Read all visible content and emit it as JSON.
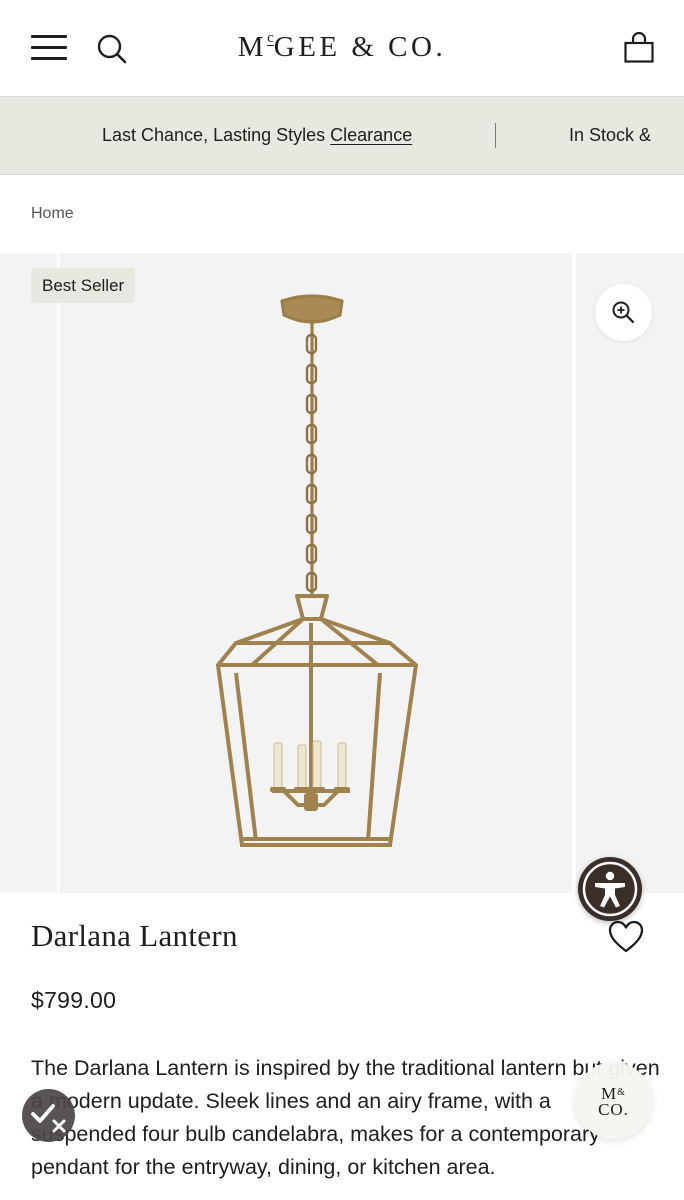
{
  "header": {
    "logo_main": "McGEE & CO.",
    "logo_prefix": "M",
    "logo_sup": "c",
    "logo_rest": "GEE & CO.",
    "menu_icon": "hamburger-menu-icon",
    "search_icon": "search-icon",
    "cart_icon": "shopping-bag-icon"
  },
  "promo": {
    "text": "Last Chance, Lasting Styles",
    "link": "Clearance",
    "text2": "In Stock &"
  },
  "breadcrumb": {
    "home": "Home"
  },
  "gallery": {
    "badge": "Best Seller",
    "zoom_icon": "zoom-in-icon",
    "image_subject": "lantern-pendant-image"
  },
  "product": {
    "title": "Darlana Lantern",
    "price": "$799.00",
    "description": "The Darlana Lantern is inspired by the traditional lantern but given a modern update. Sleek lines and an airy frame, with a suspended four bulb candelabra, makes for a contemporary pendant for the entryway, dining, or kitchen area.",
    "wishlist_icon": "heart-icon"
  },
  "floating": {
    "accessibility_icon": "accessibility-icon",
    "check_icon": "checkmark-close-icon",
    "chat_logo_line1": "M",
    "chat_logo_amp": "&",
    "chat_logo_line2": "CO."
  },
  "colors": {
    "banner_bg": "#e8e7e0",
    "text": "#1e1e1e",
    "accessibility_bg": "#3a2e29",
    "brass": "#a0824e"
  }
}
